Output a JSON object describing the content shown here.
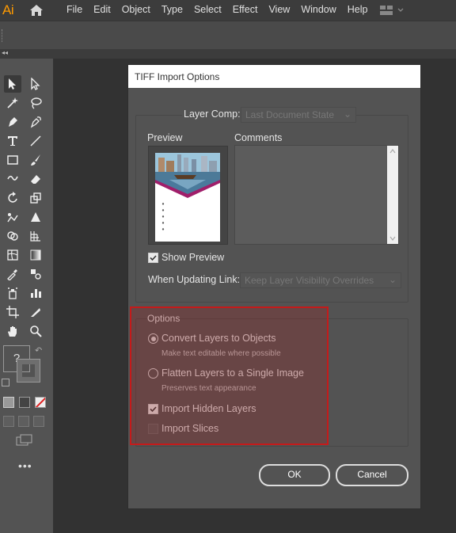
{
  "app": {
    "logo": "Ai"
  },
  "menu": [
    "File",
    "Edit",
    "Object",
    "Type",
    "Select",
    "Effect",
    "View",
    "Window",
    "Help"
  ],
  "dialog": {
    "title": "TIFF Import Options",
    "layer_comp_label": "Layer Comp:",
    "layer_comp_value": "Last Document State",
    "preview_label": "Preview",
    "comments_label": "Comments",
    "show_preview_label": "Show Preview",
    "show_preview_checked": true,
    "updating_link_label": "When Updating Link:",
    "updating_link_value": "Keep Layer Visibility Overrides",
    "options_legend": "Options",
    "convert_label": "Convert Layers to Objects",
    "convert_sub": "Make text editable where possible",
    "convert_selected": true,
    "flatten_label": "Flatten Layers to a Single Image",
    "flatten_sub": "Preserves text appearance",
    "flatten_selected": false,
    "import_hidden_label": "Import Hidden Layers",
    "import_hidden_checked": true,
    "import_slices_label": "Import Slices",
    "import_slices_checked": false,
    "ok_label": "OK",
    "cancel_label": "Cancel"
  },
  "colors": {
    "highlight": "#c51a1a",
    "logo": "#ff9a00"
  },
  "icons": [
    "home-icon",
    "workspace-switcher-icon",
    "selection-tool-icon",
    "direct-selection-tool-icon",
    "magic-wand-tool-icon",
    "lasso-tool-icon",
    "pen-tool-icon",
    "curvature-tool-icon",
    "type-tool-icon",
    "line-tool-icon",
    "rectangle-tool-icon",
    "paintbrush-tool-icon",
    "shaper-tool-icon",
    "eraser-tool-icon",
    "rotate-tool-icon",
    "scale-tool-icon",
    "puppet-warp-tool-icon",
    "free-transform-tool-icon",
    "shape-builder-tool-icon",
    "perspective-grid-tool-icon",
    "mesh-tool-icon",
    "gradient-tool-icon",
    "eyedropper-tool-icon",
    "blend-tool-icon",
    "symbol-sprayer-tool-icon",
    "column-graph-tool-icon",
    "artboard-tool-icon",
    "slice-tool-icon",
    "hand-tool-icon",
    "zoom-tool-icon"
  ]
}
